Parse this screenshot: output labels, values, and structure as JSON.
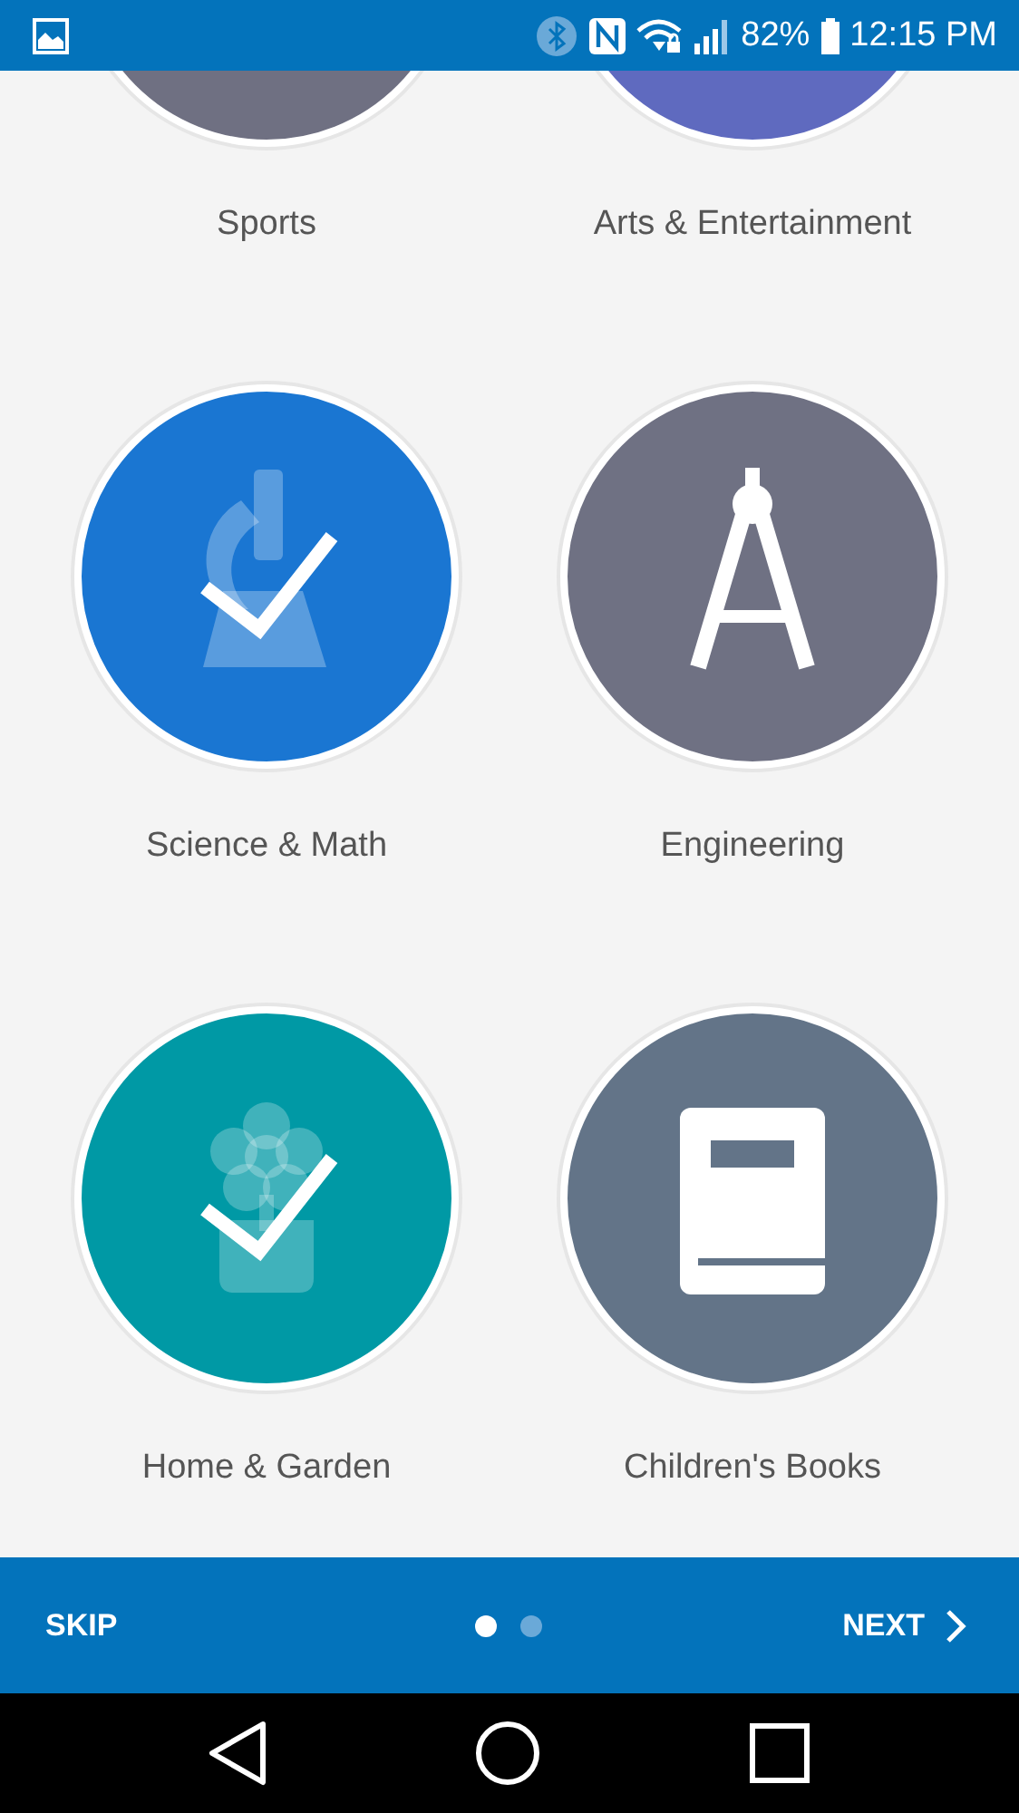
{
  "status_bar": {
    "battery": "82%",
    "time": "12:15 PM"
  },
  "categories": [
    {
      "label": "Sports",
      "color": "#6f7082"
    },
    {
      "label": "Arts & Entertainment",
      "color": "#5f6abf"
    },
    {
      "label": "Science & Math",
      "color": "#1a76d2",
      "kind": "microscope",
      "selected": true
    },
    {
      "label": "Engineering",
      "color": "#6f7183",
      "kind": "compass",
      "selected": false
    },
    {
      "label": "Home & Garden",
      "color": "#0099a5",
      "kind": "flower",
      "selected": true
    },
    {
      "label": "Children's Books",
      "color": "#637488",
      "kind": "book",
      "selected": false
    }
  ],
  "footer": {
    "skip": "SKIP",
    "next": "NEXT",
    "pages": [
      {
        "selected": true
      },
      {
        "selected": false
      }
    ]
  }
}
